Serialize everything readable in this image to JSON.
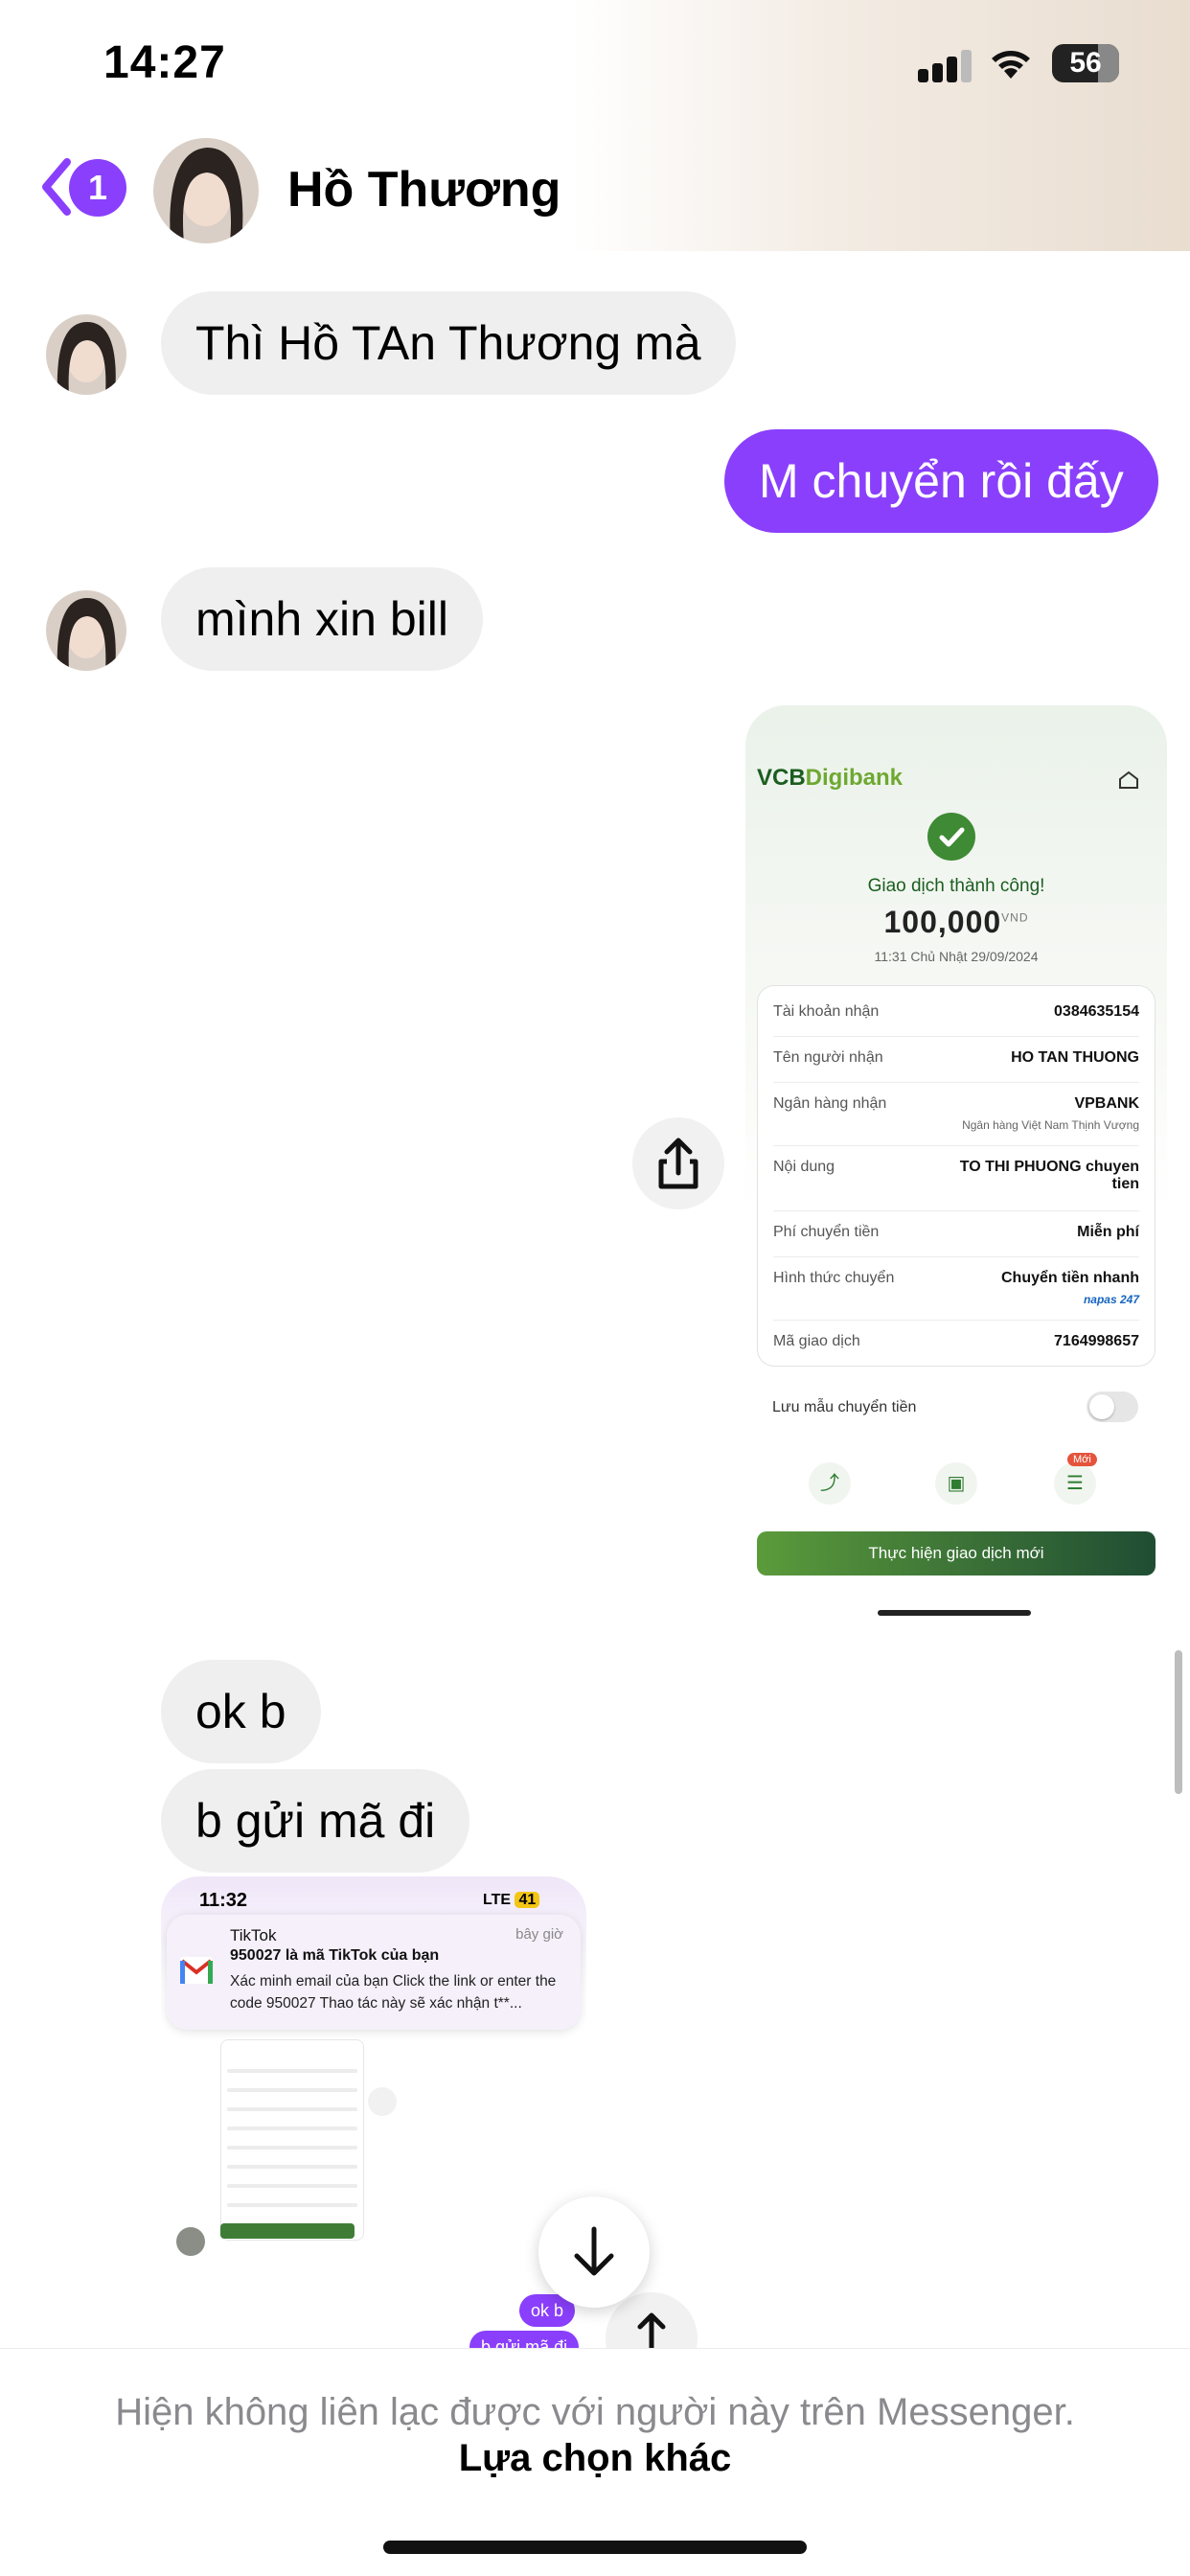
{
  "status_bar": {
    "time": "14:27",
    "battery": "56"
  },
  "header": {
    "unread_count": "1",
    "contact_name": "Hồ Thương"
  },
  "messages": {
    "m1": "Thì Hồ TAn Thương mà",
    "m2": "M chuyển rồi đấy",
    "m3": "mình xin bill",
    "m4": "ok b",
    "m5": "b gửi mã đi"
  },
  "receipt": {
    "brand_a": "VCB",
    "brand_b": "Digibank",
    "title": "Giao dịch thành công!",
    "amount": "100,000",
    "currency": "VND",
    "datetime": "11:31 Chủ Nhật 29/09/2024",
    "rows": [
      {
        "label": "Tài khoản nhận",
        "value": "0384635154"
      },
      {
        "label": "Tên người nhận",
        "value": "HO TAN THUONG"
      },
      {
        "label": "Ngân hàng nhận",
        "value": "VPBANK",
        "sub": "Ngân hàng Việt Nam Thịnh Vượng"
      },
      {
        "label": "Nội dung",
        "value": "TO THI PHUONG chuyen tien"
      },
      {
        "label": "Phí chuyển tiền",
        "value": "Miễn phí"
      },
      {
        "label": "Hình thức chuyển",
        "value": "Chuyển tiền nhanh",
        "sub": "napas 247"
      },
      {
        "label": "Mã giao dịch",
        "value": "7164998657"
      }
    ],
    "save_template": "Lưu mẫu chuyển tiền",
    "new_badge": "Mới",
    "new_tx_button": "Thực hiện giao dịch mới"
  },
  "screenshot2": {
    "time": "11:32",
    "network": "LTE",
    "battery": "41",
    "notification": {
      "app": "TikTok",
      "when": "bây giờ",
      "title": "950027 là mã TikTok của bạn",
      "body": "Xác minh email của bạn Click the link or enter the code 950027 Thao tác này sẽ xác nhận t**..."
    },
    "peek_bubble_1": "ok b",
    "peek_bubble_2": "b gửi mã đi"
  },
  "footer": {
    "message": "Hiện không liên lạc được với người này trên Messenger.",
    "link": "Lựa chọn khác"
  },
  "colors": {
    "accent": "#8a3ffc",
    "incoming_bubble": "#efefef",
    "vcb_green": "#3f8a34"
  }
}
